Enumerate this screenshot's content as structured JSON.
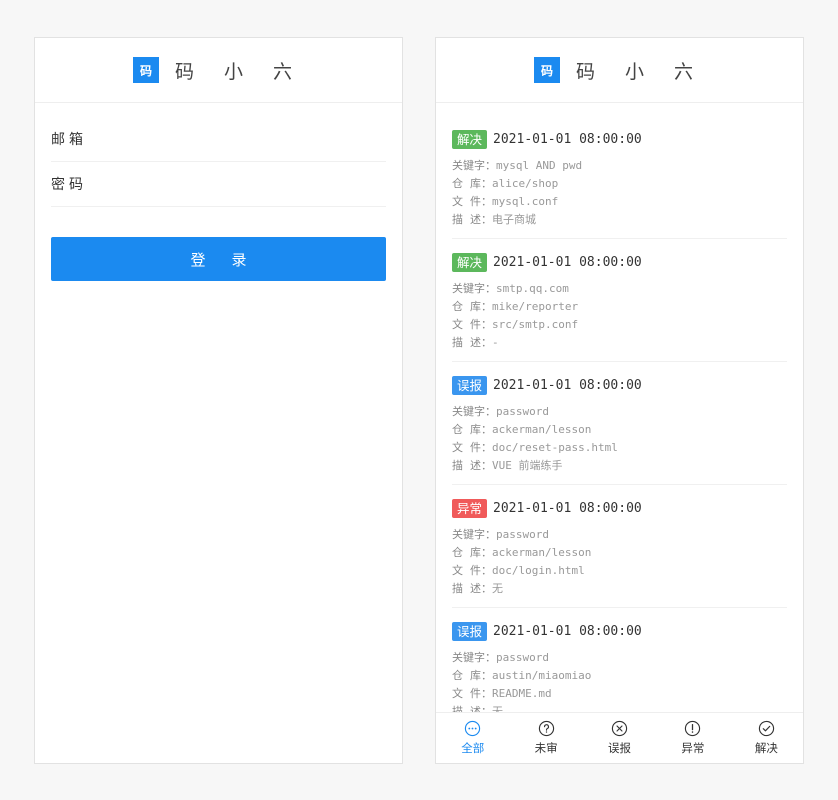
{
  "brand": {
    "logo": "码小六 logo",
    "name": "码 小 六"
  },
  "login": {
    "email_label": "邮箱",
    "password_label": "密码",
    "submit_label": "登录"
  },
  "list": {
    "items": [
      {
        "tag": "解决",
        "tag_kind": "solve",
        "time": "2021-01-01 08:00:00",
        "keyword_label": "关键字：",
        "keyword": "mysql AND pwd",
        "repo_label": "仓  库：",
        "repo": "alice/shop",
        "file_label": "文  件：",
        "file": "mysql.conf",
        "desc_label": "描  述：",
        "desc": "电子商城"
      },
      {
        "tag": "解决",
        "tag_kind": "solve",
        "time": "2021-01-01 08:00:00",
        "keyword_label": "关键字：",
        "keyword": "smtp.qq.com",
        "repo_label": "仓  库：",
        "repo": "mike/reporter",
        "file_label": "文  件：",
        "file": "src/smtp.conf",
        "desc_label": "描  述：",
        "desc": "-"
      },
      {
        "tag": "误报",
        "tag_kind": "misreport",
        "time": "2021-01-01 08:00:00",
        "keyword_label": "关键字：",
        "keyword": "password",
        "repo_label": "仓  库：",
        "repo": "ackerman/lesson",
        "file_label": "文  件：",
        "file": "doc/reset-pass.html",
        "desc_label": "描  述：",
        "desc": "VUE 前端练手"
      },
      {
        "tag": "异常",
        "tag_kind": "error",
        "time": "2021-01-01 08:00:00",
        "keyword_label": "关键字：",
        "keyword": "password",
        "repo_label": "仓  库：",
        "repo": "ackerman/lesson",
        "file_label": "文  件：",
        "file": "doc/login.html",
        "desc_label": "描  述：",
        "desc": "无"
      },
      {
        "tag": "误报",
        "tag_kind": "misreport",
        "time": "2021-01-01 08:00:00",
        "keyword_label": "关键字：",
        "keyword": "password",
        "repo_label": "仓  库：",
        "repo": "austin/miaomiao",
        "file_label": "文  件：",
        "file": "README.md",
        "desc_label": "描  述：",
        "desc": "无"
      }
    ]
  },
  "tabbar": {
    "tabs": [
      {
        "label": "全部",
        "icon": "more-icon",
        "active": true
      },
      {
        "label": "未审",
        "icon": "question-icon",
        "active": false
      },
      {
        "label": "误报",
        "icon": "close-circle-icon",
        "active": false
      },
      {
        "label": "异常",
        "icon": "exclamation-icon",
        "active": false
      },
      {
        "label": "解决",
        "icon": "check-circle-icon",
        "active": false
      }
    ]
  },
  "colors": {
    "primary": "#1b8af0",
    "solve": "#5cb85c",
    "misreport": "#3a96ef",
    "error": "#f05a5a"
  }
}
